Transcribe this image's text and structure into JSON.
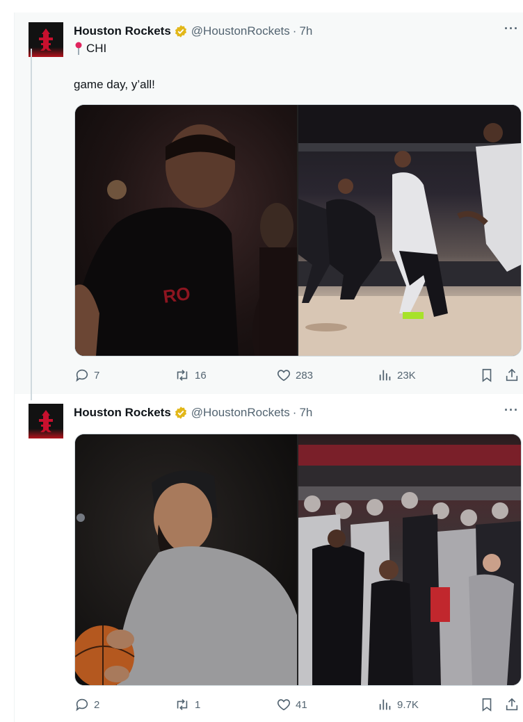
{
  "tweets": [
    {
      "name": "Houston Rockets",
      "handle": "@HoustonRockets",
      "sep": "·",
      "time": "7h",
      "location": "CHI",
      "text": "game day, y’all!",
      "stats": {
        "replies": "7",
        "retweets": "16",
        "likes": "283",
        "views": "23K"
      }
    },
    {
      "name": "Houston Rockets",
      "handle": "@HoustonRockets",
      "sep": "·",
      "time": "7h",
      "stats": {
        "replies": "2",
        "retweets": "1",
        "likes": "41",
        "views": "9.7K"
      }
    }
  ],
  "colors": {
    "verified_gold": "#e2b719",
    "muted_text": "#536471",
    "rockets_red": "#ce1141"
  },
  "icons": [
    "verified-badge-icon",
    "pin-icon",
    "more-icon",
    "reply-icon",
    "retweet-icon",
    "like-icon",
    "views-icon",
    "bookmark-icon",
    "share-icon"
  ]
}
